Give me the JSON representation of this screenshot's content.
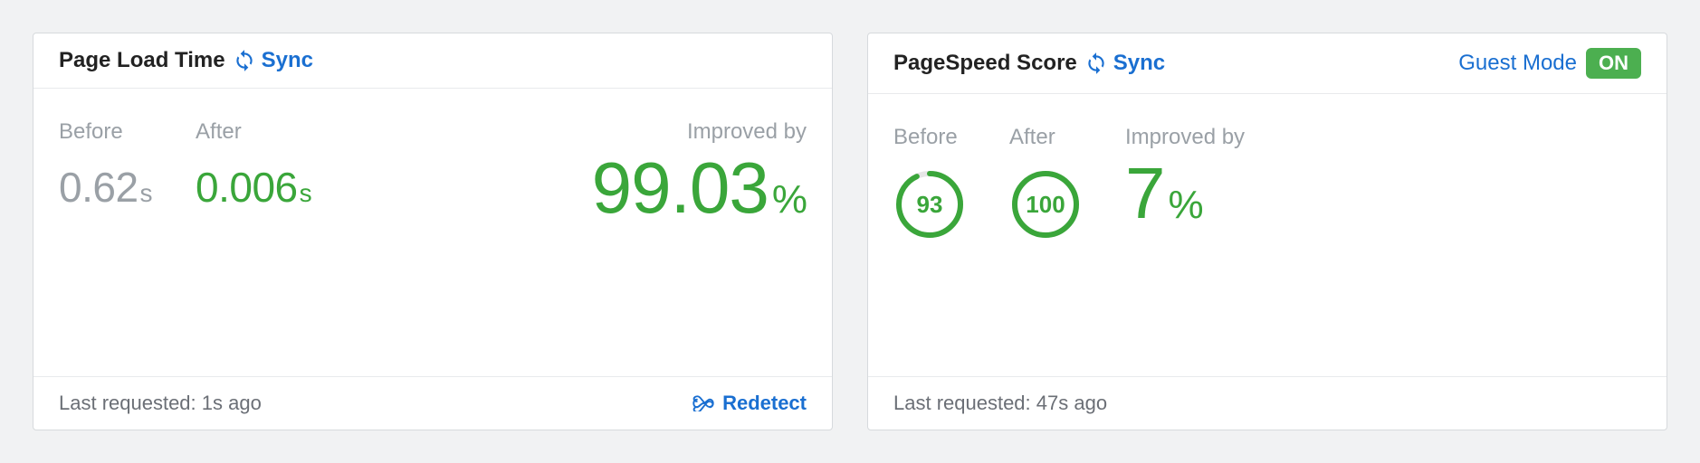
{
  "cards": {
    "load_time": {
      "title": "Page Load Time",
      "sync_label": "Sync",
      "before_label": "Before",
      "before_value": "0.62",
      "before_unit": "s",
      "after_label": "After",
      "after_value": "0.006",
      "after_unit": "s",
      "improved_label": "Improved by",
      "improved_value": "99.03",
      "improved_unit": "%",
      "footer_prefix": "Last requested: ",
      "footer_time": "1s ago",
      "redetect_label": "Redetect"
    },
    "pagespeed": {
      "title": "PageSpeed Score",
      "sync_label": "Sync",
      "guest_label": "Guest Mode",
      "guest_badge": "ON",
      "before_label": "Before",
      "before_score": "93",
      "before_percent": 93,
      "after_label": "After",
      "after_score": "100",
      "after_percent": 100,
      "improved_label": "Improved by",
      "improved_value": "7",
      "improved_unit": "%",
      "footer_prefix": "Last requested: ",
      "footer_time": "47s ago"
    }
  },
  "colors": {
    "accent_blue": "#1a6fd1",
    "accent_green": "#3aa63a",
    "badge_green": "#4caf50",
    "muted_text": "#9aa0a6"
  }
}
